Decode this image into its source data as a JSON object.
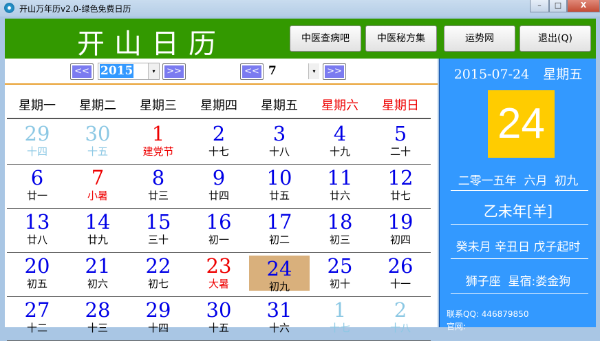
{
  "window": {
    "title": "开山万年历v2.0-绿色免费日历",
    "minimize": "–",
    "maximize": "□",
    "close": "X"
  },
  "header": {
    "logo": "开山日历",
    "buttons": [
      "中医查病吧",
      "中医秘方集",
      "运势网",
      "退出(Q)"
    ]
  },
  "nav": {
    "prev": "<<",
    "next": ">>",
    "year": "2015",
    "month": "7",
    "dropdown": "▾"
  },
  "weekdays": [
    {
      "label": "星期一"
    },
    {
      "label": "星期二"
    },
    {
      "label": "星期三"
    },
    {
      "label": "星期四"
    },
    {
      "label": "星期五"
    },
    {
      "label": "星期六",
      "weekend": true
    },
    {
      "label": "星期日",
      "weekend": true
    }
  ],
  "weeks": [
    [
      {
        "d": "29",
        "l": "十四",
        "t": "other"
      },
      {
        "d": "30",
        "l": "十五",
        "t": "other"
      },
      {
        "d": "1",
        "l": "建党节",
        "t": "holi"
      },
      {
        "d": "2",
        "l": "十七"
      },
      {
        "d": "3",
        "l": "十八"
      },
      {
        "d": "4",
        "l": "十九"
      },
      {
        "d": "5",
        "l": "二十"
      }
    ],
    [
      {
        "d": "6",
        "l": "廿一"
      },
      {
        "d": "7",
        "l": "小暑",
        "t": "holi"
      },
      {
        "d": "8",
        "l": "廿三"
      },
      {
        "d": "9",
        "l": "廿四"
      },
      {
        "d": "10",
        "l": "廿五"
      },
      {
        "d": "11",
        "l": "廿六"
      },
      {
        "d": "12",
        "l": "廿七"
      }
    ],
    [
      {
        "d": "13",
        "l": "廿八"
      },
      {
        "d": "14",
        "l": "廿九"
      },
      {
        "d": "15",
        "l": "三十"
      },
      {
        "d": "16",
        "l": "初一"
      },
      {
        "d": "17",
        "l": "初二"
      },
      {
        "d": "18",
        "l": "初三"
      },
      {
        "d": "19",
        "l": "初四"
      }
    ],
    [
      {
        "d": "20",
        "l": "初五"
      },
      {
        "d": "21",
        "l": "初六"
      },
      {
        "d": "22",
        "l": "初七"
      },
      {
        "d": "23",
        "l": "大暑",
        "t": "holi"
      },
      {
        "d": "24",
        "l": "初九",
        "t": "selected"
      },
      {
        "d": "25",
        "l": "初十"
      },
      {
        "d": "26",
        "l": "十一"
      }
    ],
    [
      {
        "d": "27",
        "l": "十二"
      },
      {
        "d": "28",
        "l": "十三"
      },
      {
        "d": "29",
        "l": "十四"
      },
      {
        "d": "30",
        "l": "十五"
      },
      {
        "d": "31",
        "l": "十六"
      },
      {
        "d": "1",
        "l": "十七",
        "t": "other"
      },
      {
        "d": "2",
        "l": "十八",
        "t": "other"
      }
    ]
  ],
  "side": {
    "date": "2015-07-24",
    "weekday": "星期五",
    "day": "24",
    "lunar": "二零一五年  六月  初九",
    "year_gz": "乙未年[羊]",
    "ganzhi": "癸未月 辛丑日 戊子起时",
    "zodiac": "狮子座  星宿:娄金狗",
    "qq": "联系QQ: 446879850",
    "site": "官网:"
  },
  "colors": {
    "header": "#339900",
    "side": "#3399ff",
    "selected": "#d9b07c",
    "today_box": "#ffcc00"
  }
}
